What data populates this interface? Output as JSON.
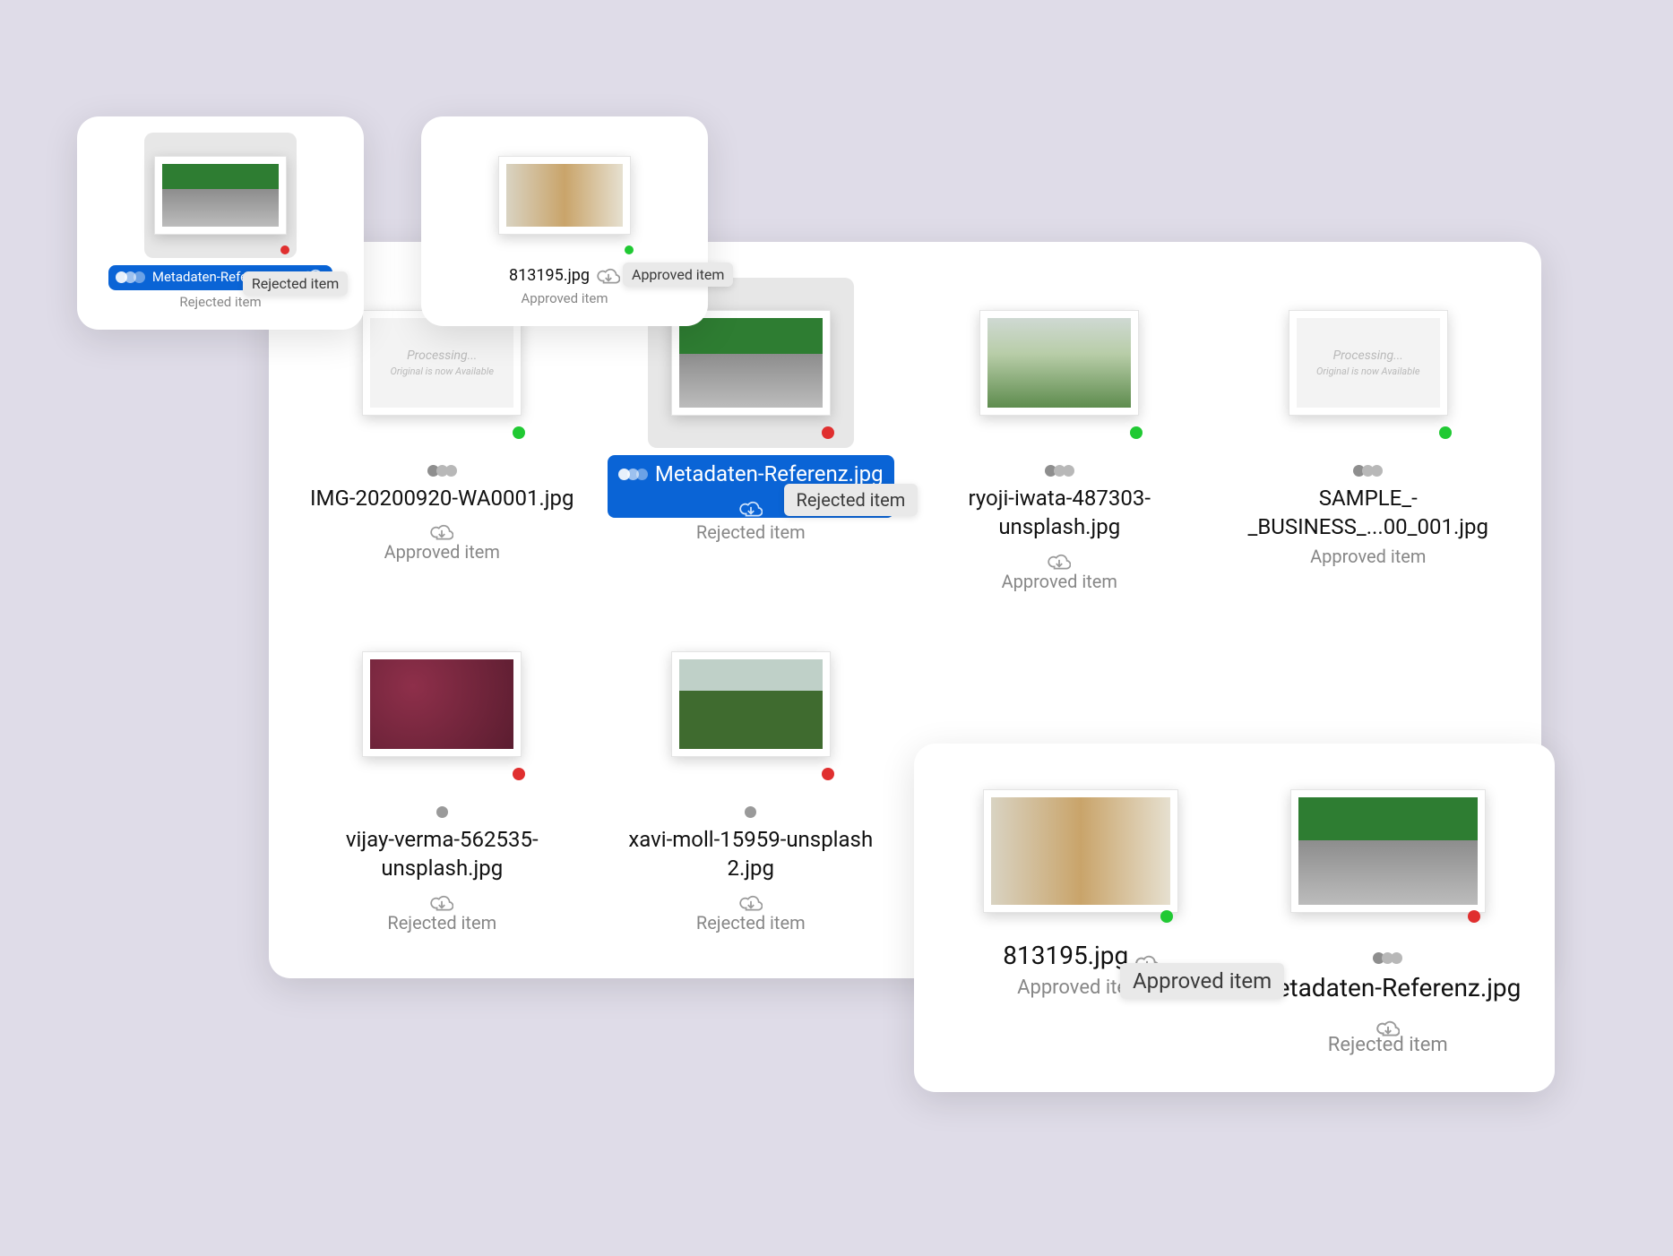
{
  "processing": {
    "title": "Processing...",
    "subtitle": "Original is now Available"
  },
  "tooltips": {
    "rejected": "Rejected item",
    "approved": "Approved item"
  },
  "status": {
    "approved": "Approved item",
    "rejected": "Rejected item"
  },
  "popout1": {
    "filename": "Metadaten-Referenz.jpg",
    "status_key": "rejected",
    "dot": "red",
    "selected": true
  },
  "popout2": {
    "filename": "813195.jpg",
    "status_key": "approved",
    "dot": "green",
    "selected": false
  },
  "grid": [
    {
      "filename": "IMG-20200920-WA0001.jpg",
      "status_key": "approved",
      "dot": "green",
      "processing": true,
      "versions": true,
      "selected": false
    },
    {
      "filename": "Metadaten-Referenz.jpg",
      "status_key": "rejected",
      "dot": "red",
      "image": "road",
      "versions": true,
      "selected": true
    },
    {
      "filename": "ryoji-iwata-487303-unsplash.jpg",
      "status_key": "approved",
      "dot": "green",
      "image": "hills",
      "versions": true,
      "selected": false
    },
    {
      "filename": "SAMPLE_-_BUSINESS_...00_001.jpg",
      "status_key": "approved",
      "dot": "green",
      "processing": true,
      "versions": true,
      "selected": false
    },
    {
      "filename": "vijay-verma-562535-unsplash.jpg",
      "status_key": "rejected",
      "dot": "red",
      "image": "fruit",
      "versions": false,
      "selected": false
    },
    {
      "filename": "xavi-moll-15959-unsplash 2.jpg",
      "status_key": "rejected",
      "dot": "red",
      "image": "field",
      "versions": false,
      "selected": false
    }
  ],
  "popout_lr": [
    {
      "filename": "813195.jpg",
      "status_key": "approved",
      "dot": "green",
      "image": "baskets",
      "versions": false
    },
    {
      "filename": "Metadaten-Referenz.jpg",
      "status_key": "rejected",
      "dot": "red",
      "image": "road",
      "versions": true
    }
  ]
}
